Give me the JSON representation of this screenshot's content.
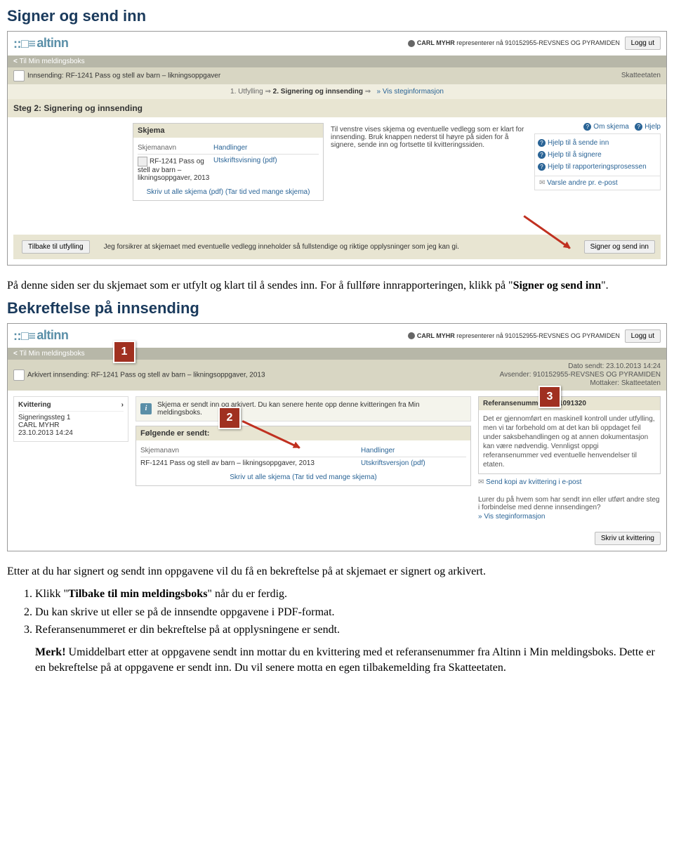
{
  "doc": {
    "h1": "Signer og send inn",
    "p1a": "På denne siden ser du skjemaet som er utfylt og klart til å sendes inn. For å fullføre innrapporteringen, klikk på \"",
    "p1b": "Signer og send inn",
    "p1c": "\".",
    "h2": "Bekreftelse på innsending",
    "p2": "Etter at du har signert og sendt inn oppgavene vil du få en bekreftelse på at skjemaet er signert og arkivert.",
    "li1a": "Klikk \"",
    "li1b": "Tilbake til min meldingsboks",
    "li1c": "\" når du er ferdig.",
    "li2": "Du kan skrive ut eller se på de innsendte oppgavene i PDF-format.",
    "li3": "Referansenummeret er din bekreftelse på at opplysningene er sendt.",
    "merk_label": "Merk!",
    "merk_text": " Umiddelbart etter at oppgavene sendt inn mottar du en kvittering med et referansenummer fra Altinn i Min meldingsboks. Dette er en bekreftelse på at oppgavene er sendt inn. Du vil senere motta en egen tilbakemelding fra Skatteetaten."
  },
  "shot1": {
    "brand": "altinn",
    "user_name": "CARL MYHR",
    "user_rep": " representerer nå 910152955-REVSNES OG PYRAMIDEN",
    "logout": "Logg ut",
    "back": "Til Min meldingsboks",
    "title": "Innsending: RF-1241 Pass og stell av barn – likningsoppgaver",
    "etat": "Skatteetaten",
    "steps_1": "1. Utfylling",
    "steps_2": "2. Signering og innsending",
    "steps_link": "» Vis steginformasjon",
    "stepheading": "Steg 2: Signering og innsending",
    "skjema_head": "Skjema",
    "instr": "Til venstre vises skjema og eventuelle vedlegg som er klart for innsending. Bruk knappen nederst til høyre på siden for å signere, sende inn og fortsette til kvitteringssiden.",
    "om": "Om skjema",
    "hjelp": "Hjelp",
    "col1": "Skjemanavn",
    "col2": "Handlinger",
    "row_name": "RF-1241 Pass og stell av barn – likningsoppgaver, 2013",
    "row_action": "Utskriftsvisning (pdf)",
    "print_all": "Skriv ut alle skjema (pdf) (Tar tid ved mange skjema)",
    "help1": "Hjelp til å sende inn",
    "help2": "Hjelp til å signere",
    "help3": "Hjelp til rapporteringsprosessen",
    "notify": "Varsle andre pr. e-post",
    "btn_back": "Tilbake til utfylling",
    "decl": "Jeg forsikrer at skjemaet med eventuelle vedlegg inneholder så fullstendige og riktige opplysninger som jeg kan gi.",
    "btn_sign": "Signer og send inn"
  },
  "shot2": {
    "brand": "altinn",
    "user_name": "CARL MYHR",
    "user_rep": " representerer nå 910152955-REVSNES OG PYRAMIDEN",
    "logout": "Logg ut",
    "back": "Til Min meldingsboks",
    "title": "Arkivert innsending: RF-1241 Pass og stell av barn – likningsoppgaver, 2013",
    "meta1": "Dato sendt: 23.10.2013 14:24",
    "meta2": "Avsender: 910152955-REVSNES OG PYRAMIDEN",
    "meta3": "Mottaker: Skatteetaten",
    "kvit": "Kvittering",
    "sig1": "Signeringssteg 1",
    "sig2": "CARL MYHR",
    "sig3": "23.10.2013 14:24",
    "info": "Skjema er sendt inn og arkivert. Du kan senere hente opp denne kvitteringen fra Min meldingsboks.",
    "sendt_head": "Følgende er sendt:",
    "col1": "Skjemanavn",
    "col2": "Handlinger",
    "row_name": "RF-1241 Pass og stell av barn – likningsoppgaver, 2013",
    "row_action": "Utskriftsversjon (pdf)",
    "print_all": "Skriv ut alle skjema (Tar tid ved mange skjema)",
    "ref_head": "Referansenummer: AR1091320",
    "ref_body": "Det er gjennomført en maskinell kontroll under utfylling, men vi tar forbehold om at det kan bli oppdaget feil under saksbehandlingen og at annen dokumentasjon kan være nødvendig. Vennligst oppgi referansenummer ved eventuelle henvendelser til etaten.",
    "sendcopy": "Send kopi av kvittering i e-post",
    "lurer": "Lurer du på hvem som har sendt inn eller utført andre steg i forbindelse med denne innsendingen?",
    "lurer_link": "» Vis steginformasjon",
    "btn_print": "Skriv ut kvittering",
    "c1": "1",
    "c2": "2",
    "c3": "3"
  }
}
